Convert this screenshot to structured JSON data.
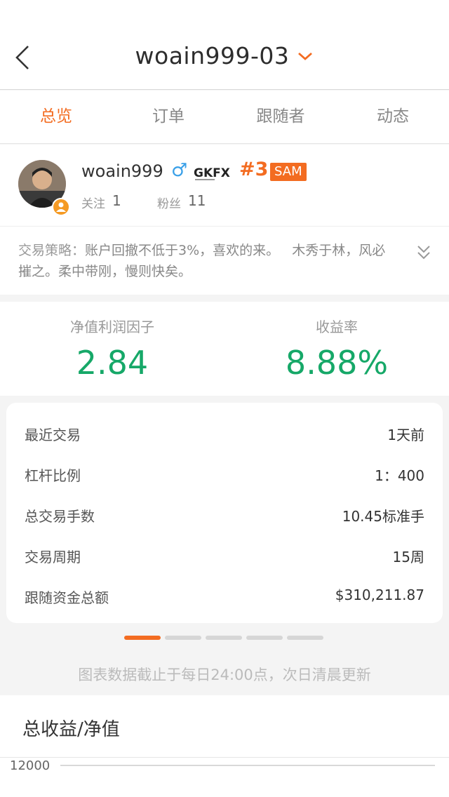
{
  "nav": {
    "title": "woain999-03",
    "back_icon": "back-arrow-icon",
    "dropdown_icon": "chevron-down-icon"
  },
  "tabs": [
    {
      "label": "总览",
      "active": true
    },
    {
      "label": "订单",
      "active": false
    },
    {
      "label": "跟随者",
      "active": false
    },
    {
      "label": "动态",
      "active": false
    }
  ],
  "profile": {
    "username": "woain999",
    "gender_symbol": "♂",
    "broker": "GKFX",
    "rank": "#3",
    "tag": "SAM",
    "follow_label": "关注",
    "follow_count": "1",
    "fans_label": "粉丝",
    "fans_count": "11"
  },
  "strategy": {
    "label": "交易策略：",
    "text": "账户回撤不低于3%，喜欢的来。   木秀于林，风必摧之。柔中带刚，慢则快矣。"
  },
  "stats": {
    "left": {
      "label": "净值利润因子",
      "value": "2.84"
    },
    "right": {
      "label": "收益率",
      "value": "8.88%"
    }
  },
  "details": [
    {
      "key": "最近交易",
      "value": "1天前"
    },
    {
      "key": "杠杆比例",
      "value": "1：400"
    },
    {
      "key": "总交易手数",
      "value": "10.45标准手"
    },
    {
      "key": "交易周期",
      "value": "15周"
    },
    {
      "key": "跟随资金总额",
      "value": "$310,211.87"
    }
  ],
  "pager": {
    "count": 5,
    "active_index": 0
  },
  "note": "图表数据截止于每日24:00点，次日清晨更新",
  "chart": {
    "title": "总收益/净值",
    "y_tick_top": "12000"
  },
  "colors": {
    "accent": "#f36c21",
    "positive": "#16a868"
  }
}
